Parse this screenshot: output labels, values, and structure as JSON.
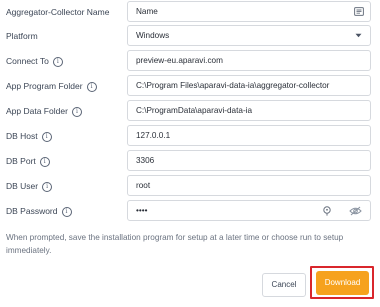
{
  "form": {
    "fields": [
      {
        "label": "Aggregator-Collector Name",
        "value": "Name",
        "info": false,
        "icon": "id-card-icon"
      },
      {
        "label": "Platform",
        "value": "Windows",
        "info": false,
        "icon": "caret-down-icon"
      },
      {
        "label": "Connect To",
        "value": "preview-eu.aparavi.com",
        "info": true
      },
      {
        "label": "App Program Folder",
        "value": "C:\\Program Files\\aparavi-data-ia\\aggregator-collector",
        "info": true
      },
      {
        "label": "App Data Folder",
        "value": "C:\\ProgramData\\aparavi-data-ia",
        "info": true
      },
      {
        "label": "DB Host",
        "value": "127.0.0.1",
        "info": true
      },
      {
        "label": "DB Port",
        "value": "3306",
        "info": true
      },
      {
        "label": "DB User",
        "value": "root",
        "info": true
      },
      {
        "label": "DB Password",
        "value": "••••",
        "info": true,
        "icons": [
          "key-icon",
          "eye-slash-icon"
        ]
      }
    ],
    "note": "When prompted, save the installation program for setup at a later time or choose run to setup immediately."
  },
  "buttons": {
    "cancel": "Cancel",
    "download": "Download"
  },
  "colors": {
    "accent": "#f6a21e",
    "highlight": "#d9262c",
    "border": "#d6d9de"
  }
}
